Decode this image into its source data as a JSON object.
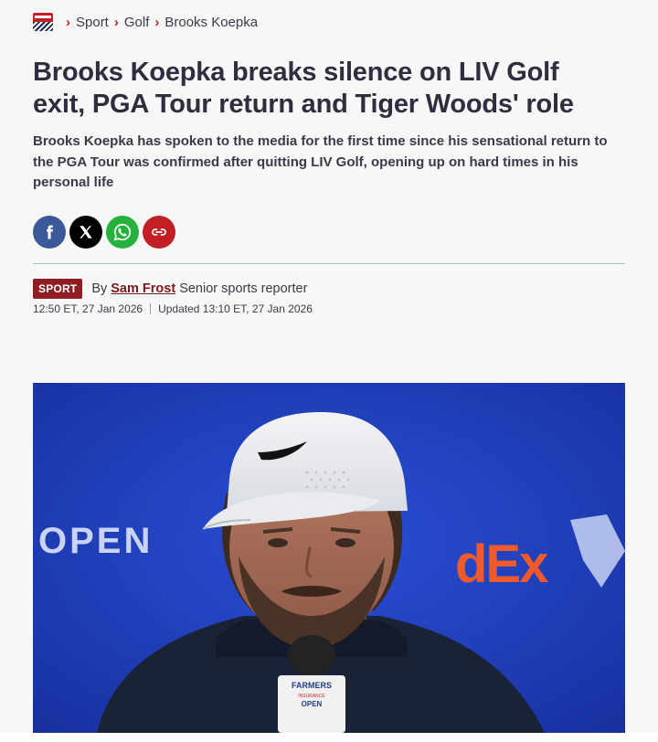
{
  "breadcrumb": {
    "items": [
      "Sport",
      "Golf",
      "Brooks Koepka"
    ]
  },
  "article": {
    "headline": "Brooks Koepka breaks silence on LIV Golf exit, PGA Tour return and Tiger Woods' role",
    "standfirst": "Brooks Koepka has spoken to the media for the first time since his sensational return to the PGA Tour was confirmed after quitting LIV Golf, opening up on hard times in his personal life",
    "section_tag": "SPORT",
    "by": "By",
    "author": "Sam Frost",
    "author_role": "Senior sports reporter",
    "published": "12:50 ET, 27 Jan 2026",
    "updated": "Updated 13:10 ET, 27 Jan 2026"
  },
  "share": {
    "icons": [
      "facebook-icon",
      "x-icon",
      "whatsapp-icon",
      "link-icon"
    ],
    "colors": {
      "facebook": "#3b5998",
      "x": "#000000",
      "whatsapp": "#25b13b",
      "link": "#c21f25"
    }
  },
  "photo": {
    "background_text_left": "OPEN",
    "background_text_right": "dEx",
    "microphone_label_top": "FARMERS",
    "microphone_label_sub": "INSURANCE",
    "microphone_label_bottom": "OPEN"
  },
  "colors": {
    "accent": "#c51d24",
    "tag": "#8f1d22",
    "author": "#7a1a1f"
  }
}
